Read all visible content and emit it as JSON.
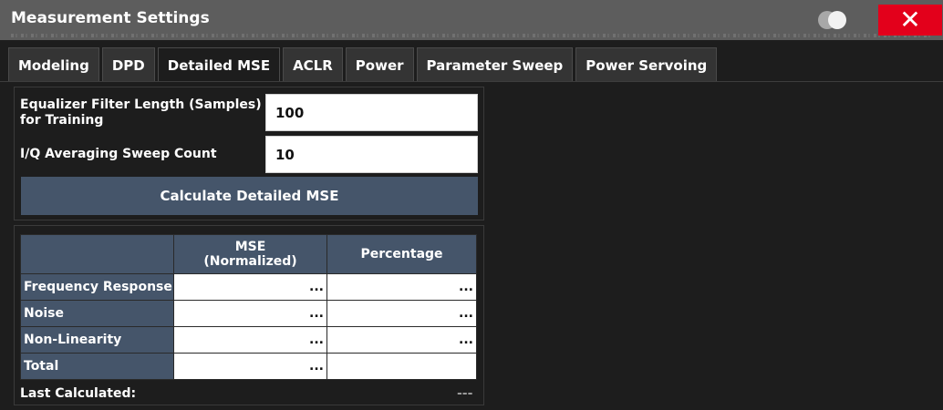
{
  "window": {
    "title": "Measurement Settings",
    "close_symbol": "✕"
  },
  "tabs": [
    {
      "label": "Modeling"
    },
    {
      "label": "DPD"
    },
    {
      "label": "Detailed MSE"
    },
    {
      "label": "ACLR"
    },
    {
      "label": "Power"
    },
    {
      "label": "Parameter Sweep"
    },
    {
      "label": "Power Servoing"
    }
  ],
  "active_tab": "Detailed MSE",
  "settings": {
    "equalizer_label_line1": "Equalizer Filter Length (Samples)",
    "equalizer_label_line2": "for Training",
    "equalizer_value": "100",
    "iq_label": "I/Q Averaging Sweep Count",
    "iq_value": "10",
    "calculate_label": "Calculate Detailed MSE"
  },
  "results": {
    "headers": [
      "",
      "MSE\n(Normalized)",
      "Percentage"
    ],
    "header_mse_line1": "MSE",
    "header_mse_line2": "(Normalized)",
    "header_pct": "Percentage",
    "rows": [
      {
        "label": "Frequency Response",
        "mse": "...",
        "pct": "..."
      },
      {
        "label": "Noise",
        "mse": "...",
        "pct": "..."
      },
      {
        "label": "Non-Linearity",
        "mse": "...",
        "pct": "..."
      },
      {
        "label": "Total",
        "mse": "...",
        "pct": ""
      }
    ],
    "last_calculated_label": "Last Calculated:",
    "last_calculated_value": "---"
  },
  "colors": {
    "close_button": "#e3001b",
    "header_fill": "#45556a",
    "background": "#1d1d1d"
  }
}
